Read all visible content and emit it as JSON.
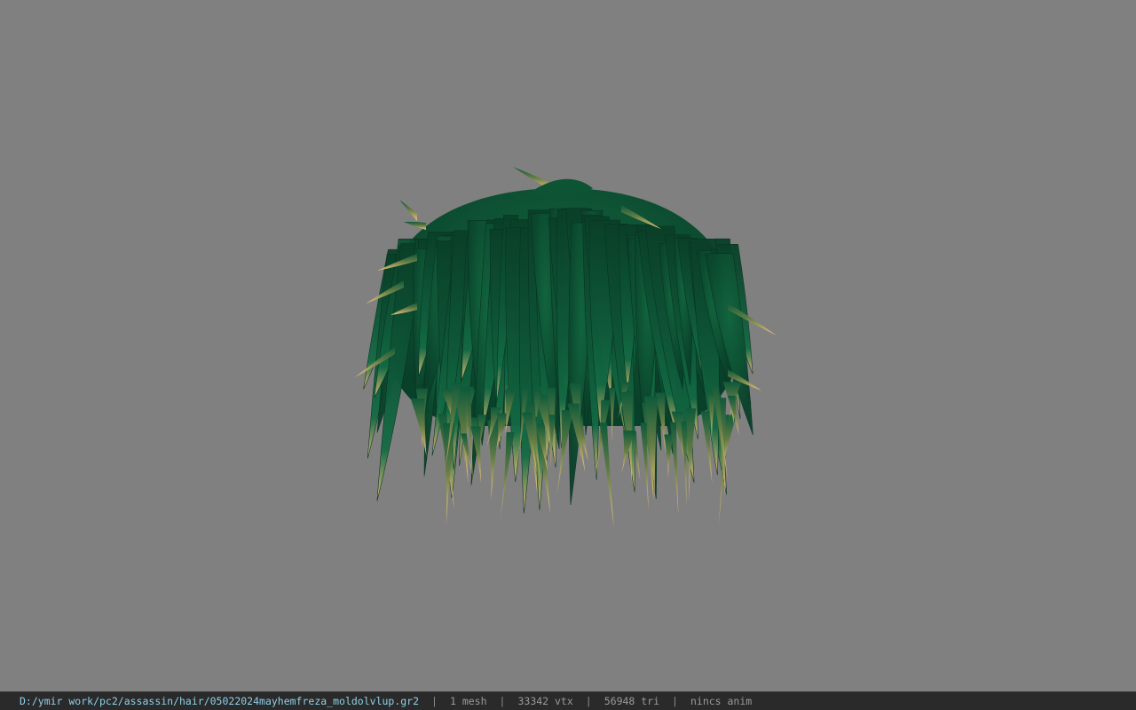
{
  "viewer": {
    "background_color": "#808080",
    "model_icon": "hair-mesh-preview",
    "hair_colors": {
      "primary": "#0f5a3a",
      "dark": "#0a3f28",
      "highlight": "#2e8a5e",
      "tip": "#e6be74"
    }
  },
  "status_bar": {
    "file_path": "D:/ymir work/pc2/assassin/hair/05022024mayhemfreza_moldolvlup.gr2",
    "separator": "|",
    "mesh_count": "1 mesh",
    "vertex_count": "33342 vtx",
    "triangle_count": "56948 tri",
    "anim_status": "nincs anim"
  }
}
